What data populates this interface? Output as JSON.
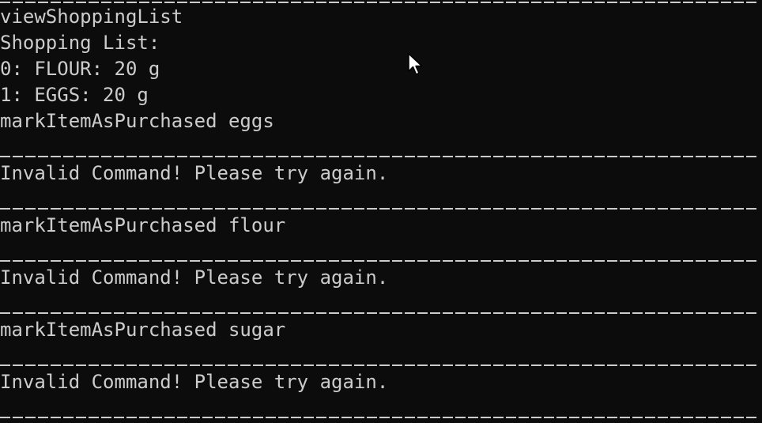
{
  "terminal": {
    "lines": [
      "viewShoppingList",
      "Shopping List:",
      "0: FLOUR: 20 g",
      "1: EGGS: 20 g",
      "markItemAsPurchased eggs",
      "Invalid Command! Please try again.",
      "markItemAsPurchased flour",
      "Invalid Command! Please try again.",
      "markItemAsPurchased sugar",
      "Invalid Command! Please try again."
    ],
    "separator_glyph": "_",
    "colors": {
      "background": "#0c0c0c",
      "text": "#cccccc"
    }
  },
  "cursor": {
    "icon": "mouse-pointer-icon"
  }
}
